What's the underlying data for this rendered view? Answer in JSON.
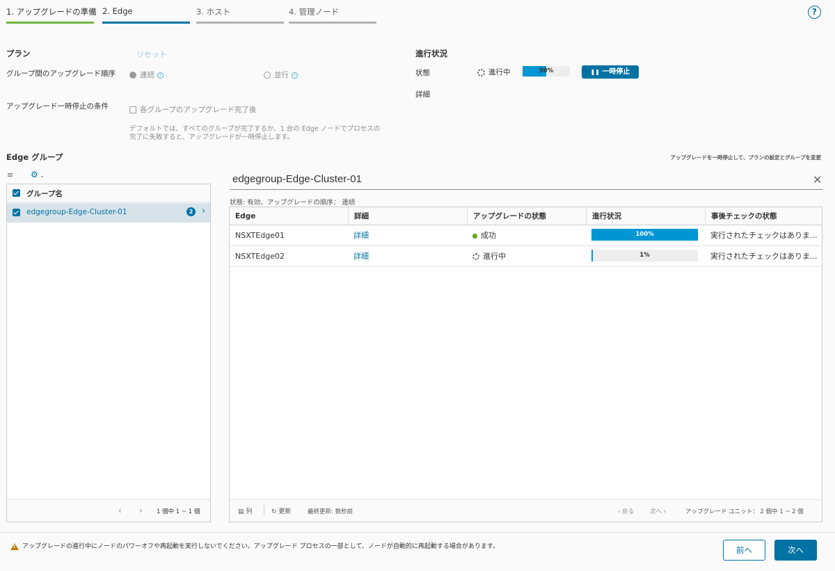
{
  "wizard": {
    "steps": [
      {
        "label": "1. アップグレードの準備"
      },
      {
        "label": "2. Edge"
      },
      {
        "label": "3. ホスト"
      },
      {
        "label": "4. 管理ノード"
      }
    ],
    "help_icon": "?"
  },
  "plan": {
    "title": "プラン",
    "reset": "リセット",
    "order_label": "グループ間のアップグレード順序",
    "option_serial": "連続",
    "option_parallel": "並行",
    "pause_label": "アップグレード一時停止の条件",
    "pause_option": "各グループのアップグレード完了後",
    "desc_line1": "デフォルトでは、すべてのグループが完了するか、1 台の Edge ノードでプロセスの",
    "desc_line2": "完了に失敗すると、アップグレードが一時停止します。"
  },
  "progress": {
    "title": "進行状況",
    "status_label": "状態",
    "status_value": "進行中",
    "percent": 50,
    "percent_text": "50%",
    "pause_button": "一時停止",
    "details_label": "詳細"
  },
  "edge_groups": {
    "title": "Edge グループ",
    "change_note": "アップグレードを一時停止して、プランの設定とグループを変更",
    "column_header": "グループ名",
    "items": [
      {
        "name": "edgegroup-Edge-Cluster-01",
        "count": "2"
      }
    ],
    "pagination": "1 個中 1 ~ 1 個",
    "prev": "‹",
    "next": "›"
  },
  "detail": {
    "title": "edgegroup-Edge-Cluster-01",
    "status_line": "状態: 有効、アップグレードの順序： 連続",
    "columns": [
      "Edge",
      "詳細",
      "アップグレードの状態",
      "進行状況",
      "事後チェックの状態"
    ],
    "rows": [
      {
        "edge": "NSXTEdge01",
        "details": "詳細",
        "status": "成功",
        "progress": 100,
        "progress_text": "100%",
        "postcheck": "実行されたチェックはありま..."
      },
      {
        "edge": "NSXTEdge02",
        "details": "詳細",
        "status": "進行中",
        "progress": 1,
        "progress_text": "1%",
        "postcheck": "実行されたチェックはありま..."
      }
    ],
    "footer": {
      "columns": "列",
      "refresh": "更新",
      "last_updated": "最終更新: 数秒前",
      "back": "‹ 戻る",
      "forward": "次へ ›",
      "unit_count": "アップグレード ユニット： 2 個中 1 ~ 2 個"
    }
  },
  "bottom": {
    "warning": "アップグレードの進行中にノードのパワーオフや再起動を実行しないでください。アップグレード プロセスの一部として、ノードが自動的に再起動する場合があります。",
    "prev_button": "前へ",
    "next_button": "次へ"
  },
  "colors": {
    "primary": "#0072a3",
    "success": "#62a420",
    "progress_fill": "#0095d3",
    "step_done": "#6eb43f"
  }
}
